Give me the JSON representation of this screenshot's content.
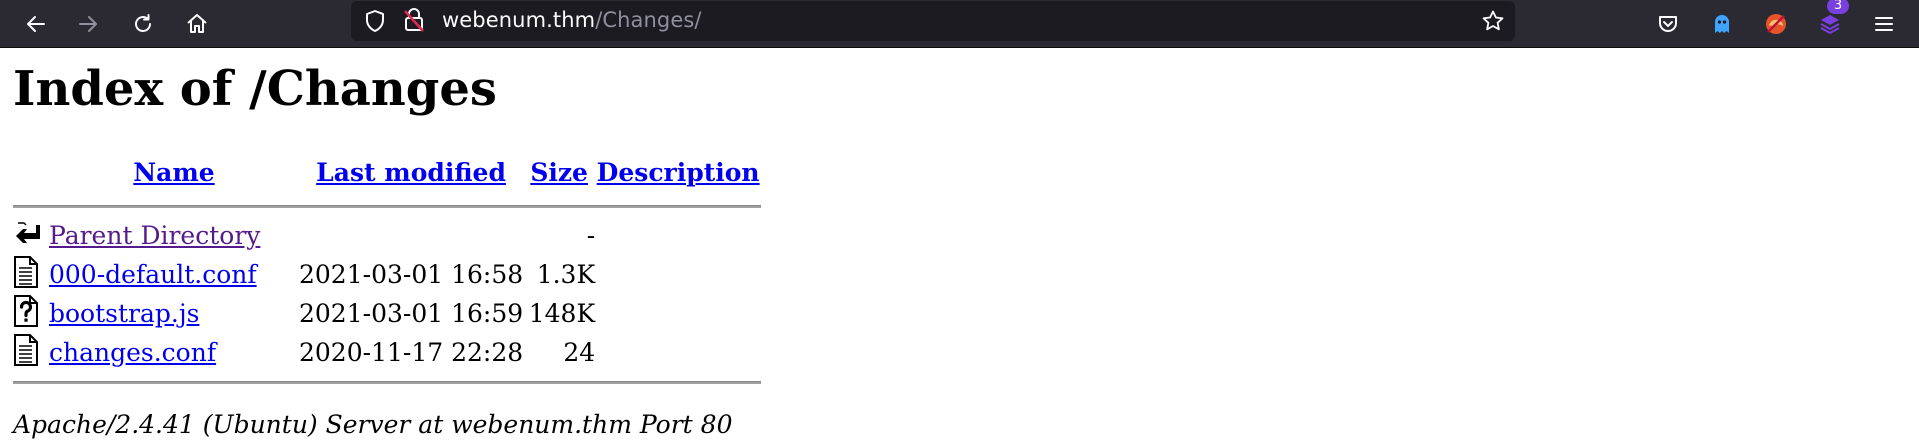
{
  "browser": {
    "url_host": "webenum.thm",
    "url_path": "/Changes/",
    "extension_badge_count": "3",
    "icons": [
      "back-arrow-icon",
      "forward-arrow-icon",
      "reload-icon",
      "home-icon",
      "shield-icon",
      "insecure-lock-icon",
      "bookmark-star-icon",
      "pocket-icon",
      "ghostery-icon",
      "extension-avatar-icon",
      "extensions-stack-icon",
      "hamburger-menu-icon"
    ]
  },
  "page": {
    "title": "Index of /Changes",
    "columns": {
      "name": "Name",
      "last_modified": "Last modified",
      "size": "Size",
      "description": "Description"
    },
    "entries": [
      {
        "icon": "parent-directory-icon",
        "name": "Parent Directory",
        "date": "",
        "size": "-",
        "visited": true
      },
      {
        "icon": "text-file-icon",
        "name": "000-default.conf",
        "date": "2021-03-01 16:58",
        "size": "1.3K",
        "visited": false
      },
      {
        "icon": "unknown-file-icon",
        "name": "bootstrap.js",
        "date": "2021-03-01 16:59",
        "size": "148K",
        "visited": false
      },
      {
        "icon": "text-file-icon",
        "name": "changes.conf",
        "date": "2020-11-17 22:28",
        "size": "24",
        "visited": false
      }
    ],
    "footer": "Apache/2.4.41 (Ubuntu) Server at webenum.thm Port 80"
  },
  "colors": {
    "toolbar_bg": "#2b2a33",
    "urlbar_bg": "#1c1b22",
    "link": "#0000ee",
    "visited_link": "#551a8b"
  }
}
